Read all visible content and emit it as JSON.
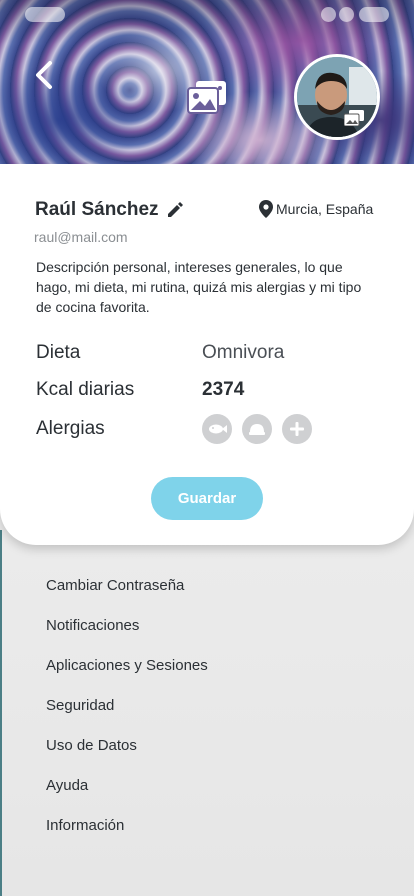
{
  "status_bar": {},
  "header": {
    "back_icon": "chevron-left-icon",
    "cover_icon": "image-gallery-icon",
    "avatar_badge_icon": "image-gallery-icon"
  },
  "profile": {
    "name": "Raúl Sánchez",
    "location": "Murcia, España",
    "email": "raul@mail.com",
    "description": "Descripción personal, intereses generales, lo que hago, mi dieta, mi rutina, quizá mis alergias y mi tipo de cocina favorita."
  },
  "fields": {
    "dieta_label": "Dieta",
    "dieta_value": "Omnivora",
    "kcal_label": "Kcal diarias",
    "kcal_value": "2374",
    "alergias_label": "Alergias",
    "alergias_icons": [
      "fish-icon",
      "egg-icon",
      "plus-icon"
    ]
  },
  "actions": {
    "save_label": "Guardar"
  },
  "menu": {
    "items": [
      "Cambiar Contraseña",
      "Notificaciones",
      "Aplicaciones y Sesiones",
      "Seguridad",
      "Uso de Datos",
      "Ayuda",
      "Información"
    ]
  },
  "colors": {
    "accent": "#7fd3ea",
    "text": "#2b3035",
    "muted": "#8a8e92",
    "icon_bg": "#cfd0d2"
  }
}
